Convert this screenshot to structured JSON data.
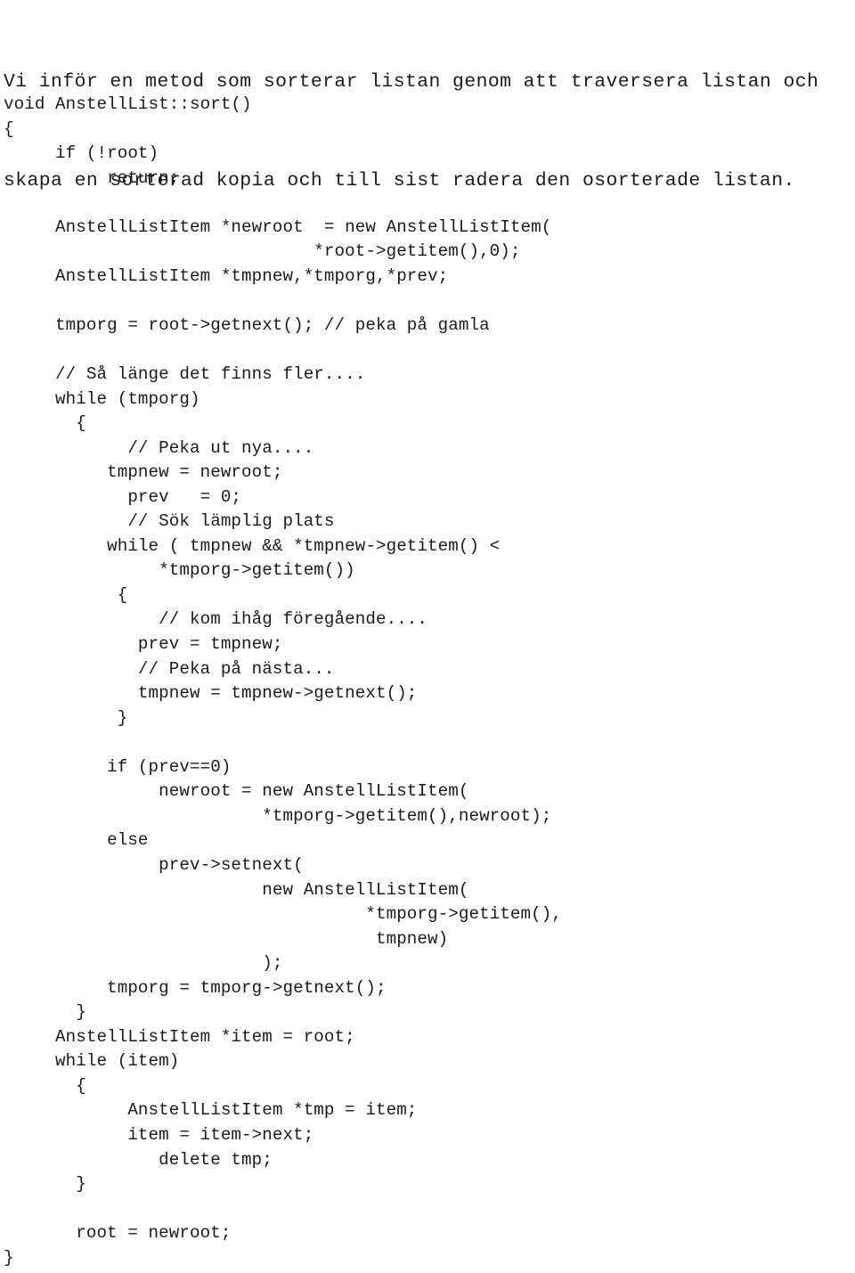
{
  "document": {
    "language": "sv",
    "background_color": "#ffffff",
    "text_color": "#1a1a1a"
  },
  "intro": {
    "lines": [
      "Vi inför en metod som sorterar listan genom att traversera listan och",
      "skapa en sorterad kopia och till sist radera den osorterade listan."
    ]
  },
  "code": {
    "language": "cpp",
    "lines": [
      "void AnstellList::sort()",
      "{",
      "     if (!root)",
      "          return;",
      "",
      "     AnstellListItem *newroot  = new AnstellListItem(",
      "                              *root->getitem(),0);",
      "     AnstellListItem *tmpnew,*tmporg,*prev;",
      "",
      "     tmporg = root->getnext(); // peka på gamla",
      "",
      "     // Så länge det finns fler....",
      "     while (tmporg)",
      "       {",
      "            // Peka ut nya....",
      "          tmpnew = newroot;",
      "            prev   = 0;",
      "            // Sök lämplig plats",
      "          while ( tmpnew && *tmpnew->getitem() <",
      "               *tmporg->getitem())",
      "           {",
      "               // kom ihåg föregående....",
      "             prev = tmpnew;",
      "             // Peka på nästa...",
      "             tmpnew = tmpnew->getnext();",
      "           }",
      "",
      "          if (prev==0)",
      "               newroot = new AnstellListItem(",
      "                         *tmporg->getitem(),newroot);",
      "          else",
      "               prev->setnext(",
      "                         new AnstellListItem(",
      "                                   *tmporg->getitem(),",
      "                                    tmpnew)",
      "                         );",
      "          tmporg = tmporg->getnext();",
      "       }",
      "     AnstellListItem *item = root;",
      "     while (item)",
      "       {",
      "            AnstellListItem *tmp = item;",
      "            item = item->next;",
      "               delete tmp;",
      "       }",
      "",
      "       root = newroot;",
      "}"
    ]
  }
}
